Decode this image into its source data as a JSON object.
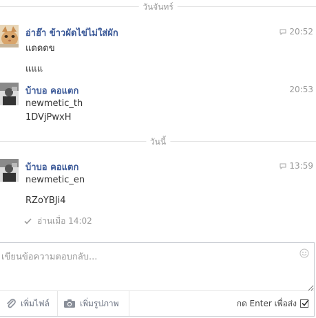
{
  "dividers": {
    "sunday": "วันจันทร์",
    "today": "วันนี้"
  },
  "messages": [
    {
      "sender": "อ่าฮ๊า ข้าวผัดไข่ไม่ใส่ผัก",
      "time": "20:52",
      "lines": [
        "แดดดข",
        "แแแ"
      ]
    },
    {
      "sender": "บ้าบอ คอแตก",
      "time": "20:53",
      "lines": [
        "newmetic_th",
        "1DVjPwxH"
      ]
    },
    {
      "sender": "บ้าบอ คอแตก",
      "time": "13:59",
      "lines": [
        "newmetic_en",
        "RZoYBJi4"
      ]
    }
  ],
  "seen": {
    "text": "อ่านเมื่อ 14:02"
  },
  "composer": {
    "placeholder": "เขียนข้อความตอบกลับ...",
    "attach_label": "เพิ่มไฟล์",
    "photo_label": "เพิ่มรูปภาพ",
    "enter_label": "กด Enter เพื่อส่ง",
    "enter_checked": true
  },
  "icons": {
    "message_time": "speech-bubble-icon",
    "seen": "checkmark-icon",
    "smiley": "smiley-icon",
    "attach": "paperclip-icon",
    "photo": "camera-icon",
    "checkbox": "checkbox-icon"
  }
}
